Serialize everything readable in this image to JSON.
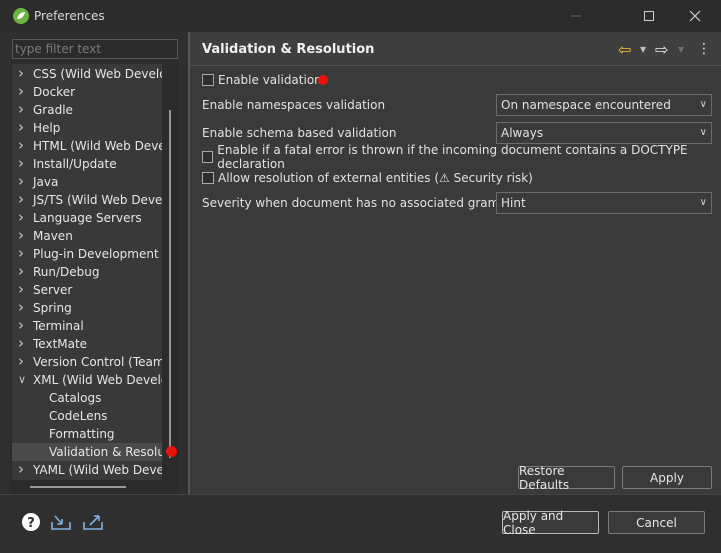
{
  "window": {
    "title": "Preferences"
  },
  "filter": {
    "placeholder": "type filter text"
  },
  "tree": {
    "items": [
      {
        "label": "CSS (Wild Web Develop",
        "expanded": false
      },
      {
        "label": "Docker",
        "expanded": false
      },
      {
        "label": "Gradle",
        "expanded": false
      },
      {
        "label": "Help",
        "expanded": false
      },
      {
        "label": "HTML (Wild Web Develo",
        "expanded": false
      },
      {
        "label": "Install/Update",
        "expanded": false
      },
      {
        "label": "Java",
        "expanded": false
      },
      {
        "label": "JS/TS (Wild Web Develo",
        "expanded": false
      },
      {
        "label": "Language Servers",
        "expanded": false
      },
      {
        "label": "Maven",
        "expanded": false
      },
      {
        "label": "Plug-in Development",
        "expanded": false
      },
      {
        "label": "Run/Debug",
        "expanded": false
      },
      {
        "label": "Server",
        "expanded": false
      },
      {
        "label": "Spring",
        "expanded": false
      },
      {
        "label": "Terminal",
        "expanded": false
      },
      {
        "label": "TextMate",
        "expanded": false
      },
      {
        "label": "Version Control (Team)",
        "expanded": false
      },
      {
        "label": "XML (Wild Web Develop",
        "expanded": true
      },
      {
        "label": "Catalogs",
        "child": true
      },
      {
        "label": "CodeLens",
        "child": true
      },
      {
        "label": "Formatting",
        "child": true
      },
      {
        "label": "Validation & Resolut",
        "child": true,
        "selected": true
      },
      {
        "label": "YAML (Wild Web Develo",
        "expanded": false
      }
    ]
  },
  "page": {
    "title": "Validation & Resolution",
    "enable_validation": {
      "label": "Enable validation",
      "checked": false
    },
    "namespaces": {
      "label": "Enable namespaces validation",
      "value": "On namespace encountered"
    },
    "schema": {
      "label": "Enable schema based validation",
      "value": "Always"
    },
    "fatal_error": {
      "label": "Enable if a fatal error is thrown if the incoming document contains a DOCTYPE declaration",
      "checked": false
    },
    "external_entities": {
      "label": "Allow resolution of external entities (⚠ Security risk)",
      "checked": false
    },
    "severity": {
      "label": "Severity when document has no associated grammar",
      "value": "Hint"
    }
  },
  "buttons": {
    "restore_defaults": "Restore Defaults",
    "apply": "Apply",
    "apply_and_close": "Apply and Close",
    "cancel": "Cancel"
  },
  "icons": {
    "app": "spring-leaf-icon",
    "help": "help-icon",
    "import": "import-icon",
    "export": "export-icon",
    "back": "back-arrow-icon",
    "forward": "forward-arrow-icon",
    "menu": "view-menu-icon"
  },
  "colors": {
    "annotation_dot": "#e8110e",
    "back_arrow": "#f2c037",
    "app_icon": "#6db33f"
  }
}
